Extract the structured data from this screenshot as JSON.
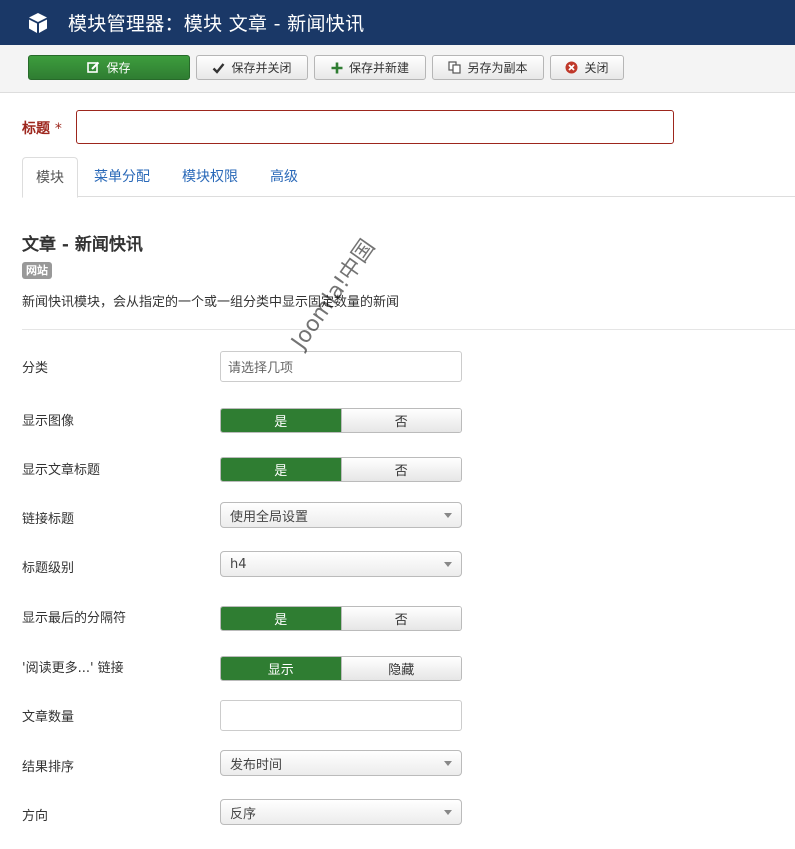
{
  "header": {
    "title": "模块管理器：模块 文章 - 新闻快讯",
    "icon": "cube-icon"
  },
  "toolbar": {
    "save": "保存",
    "save_close": "保存并关闭",
    "save_new": "保存并新建",
    "save_copy": "另存为副本",
    "close": "关闭"
  },
  "form": {
    "title_label": "标题",
    "required_mark": "*",
    "title_value": ""
  },
  "tabs": [
    "模块",
    "菜单分配",
    "模块权限",
    "高级"
  ],
  "module": {
    "name": "文章 - 新闻快讯",
    "badge": "网站",
    "description": "新闻快讯模块，会从指定的一个或一组分类中显示固定数量的新闻"
  },
  "fields": {
    "category": {
      "label": "分类",
      "placeholder": "请选择几项"
    },
    "show_image": {
      "label": "显示图像",
      "on": "是",
      "off": "否"
    },
    "show_title": {
      "label": "显示文章标题",
      "on": "是",
      "off": "否"
    },
    "link_title": {
      "label": "链接标题",
      "value": "使用全局设置"
    },
    "heading_level": {
      "label": "标题级别",
      "value": "h4"
    },
    "show_last_separator": {
      "label": "显示最后的分隔符",
      "on": "是",
      "off": "否"
    },
    "readmore": {
      "label": "'阅读更多...' 链接",
      "on": "显示",
      "off": "隐藏"
    },
    "count": {
      "label": "文章数量",
      "value": ""
    },
    "ordering": {
      "label": "结果排序",
      "value": "发布时间"
    },
    "direction": {
      "label": "方向",
      "value": "反序"
    }
  },
  "watermark": "Joomla!中国",
  "colors": {
    "header_bg": "#1a3867",
    "success": "#2f7d32",
    "danger_label": "#9d261d",
    "link": "#2a69b8"
  }
}
